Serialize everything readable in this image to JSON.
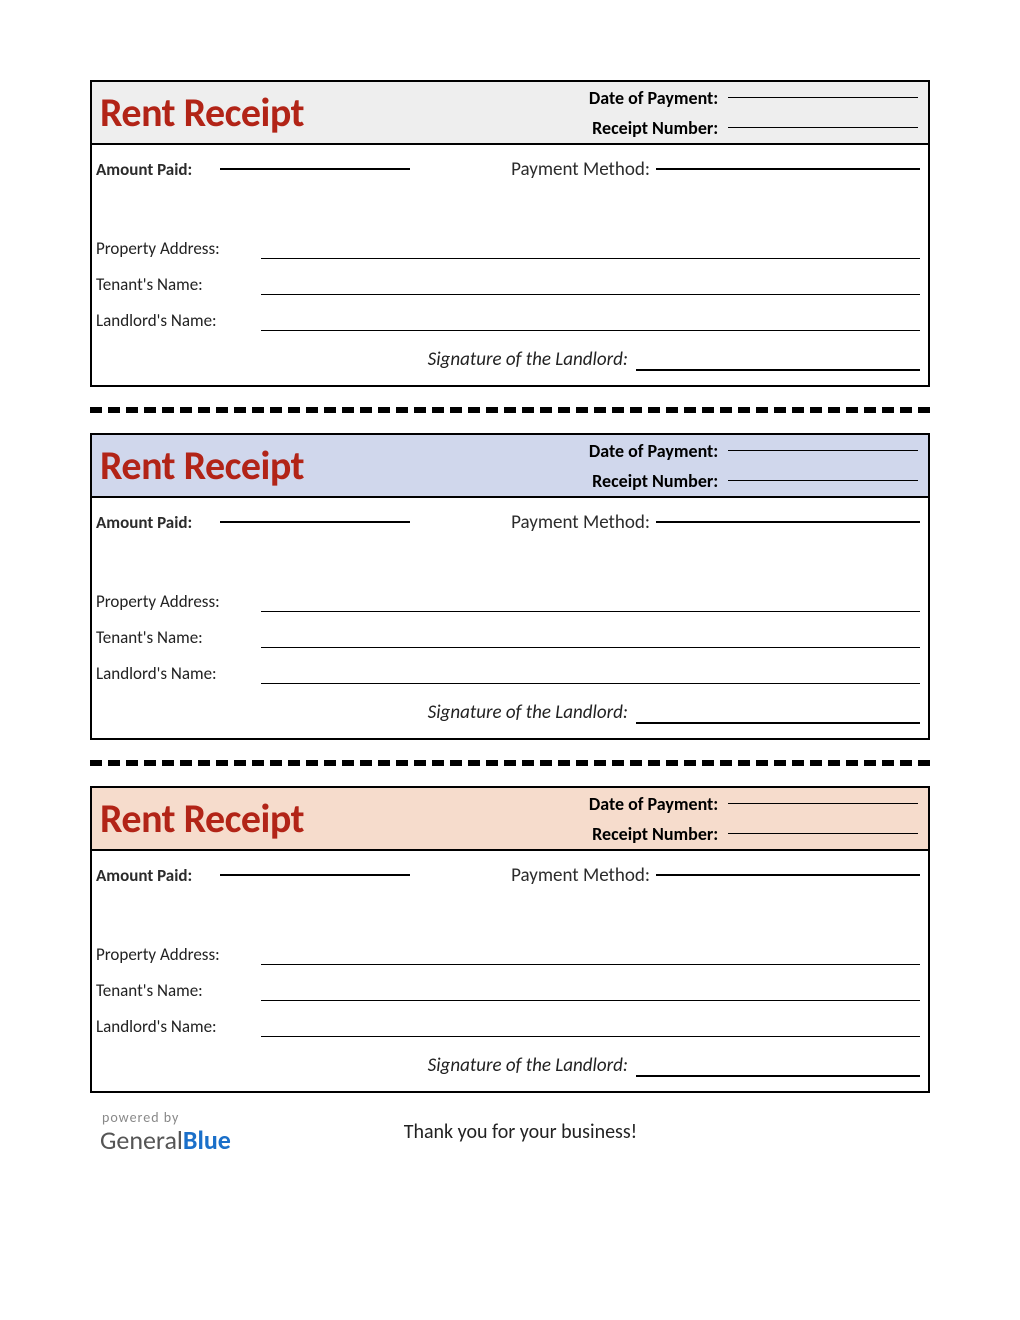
{
  "receipt": {
    "title": "Rent Receipt",
    "labels": {
      "date_of_payment": "Date of Payment:",
      "receipt_number": "Receipt Number:",
      "amount_paid": "Amount Paid:",
      "payment_method": "Payment Method:",
      "property_address": "Property Address:",
      "tenant_name": "Tenant's Name:",
      "landlord_name": "Landlord's Name:",
      "signature": "Signature of the Landlord:"
    }
  },
  "footer": {
    "powered_by": "powered by",
    "logo_general": "General",
    "logo_blue": "Blue",
    "thanks": "Thank you for your business!"
  }
}
